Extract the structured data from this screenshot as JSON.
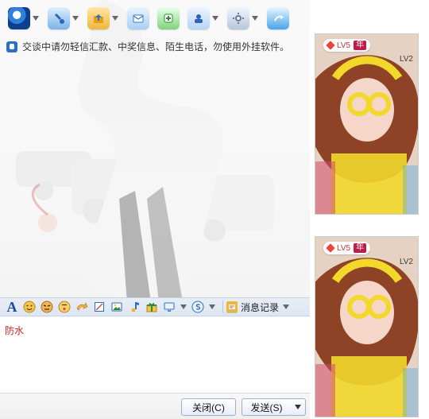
{
  "toolbar": {
    "items": [
      {
        "name": "video-icon",
        "has_dropdown": true
      },
      {
        "name": "voice-icon",
        "has_dropdown": true
      },
      {
        "name": "file-transfer-icon",
        "has_dropdown": true
      },
      {
        "name": "mail-icon",
        "has_dropdown": false
      },
      {
        "name": "add-app-icon",
        "has_dropdown": false
      },
      {
        "name": "team-icon",
        "has_dropdown": true
      },
      {
        "name": "settings-icon",
        "has_dropdown": true
      },
      {
        "name": "share-icon",
        "has_dropdown": false
      }
    ]
  },
  "notice": {
    "text": "交谈中请勿轻信汇款、中奖信息、陌生电话，勿使用外挂软件。"
  },
  "format_toolbar": {
    "font_label": "A",
    "message_record_label": "消息记录"
  },
  "input": {
    "text": "防水"
  },
  "buttons": {
    "close": "关闭(C)",
    "send": "发送(S)"
  },
  "right_panel": {
    "photos": [
      {
        "badge_level": "LV5",
        "badge_year": "年",
        "corner_level": "LV2"
      },
      {
        "badge_level": "LV5",
        "badge_year": "年",
        "corner_level": "LV2"
      }
    ]
  },
  "colors": {
    "accent_blue": "#2b6fc6",
    "input_text_red": "#c22222"
  }
}
